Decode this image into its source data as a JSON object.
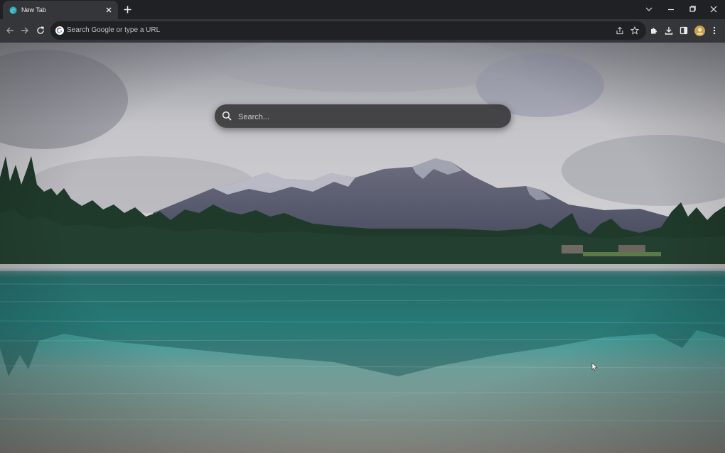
{
  "browser": {
    "tab": {
      "title": "New Tab",
      "favicon": "edge-icon"
    },
    "new_tab": "+",
    "window_controls": [
      "chevron-down-icon",
      "minimize-icon",
      "restore-icon",
      "close-icon"
    ],
    "nav": [
      "back-icon",
      "forward-icon",
      "reload-icon"
    ],
    "omnibox": {
      "placeholder": "Search Google or type a URL",
      "icon": "google-icon"
    },
    "toolbar_icons": [
      "share-icon",
      "star-icon",
      "extensions-icon",
      "download-icon",
      "sidebar-icon",
      "avatar",
      "menu-icon"
    ]
  },
  "page": {
    "search": {
      "placeholder": "Search..."
    },
    "background": "lake-and-mountains-photo",
    "colors": {
      "chrome_dark": "#202124",
      "chrome_toolbar": "#35363a",
      "search_box": "#3a3a3c"
    }
  }
}
